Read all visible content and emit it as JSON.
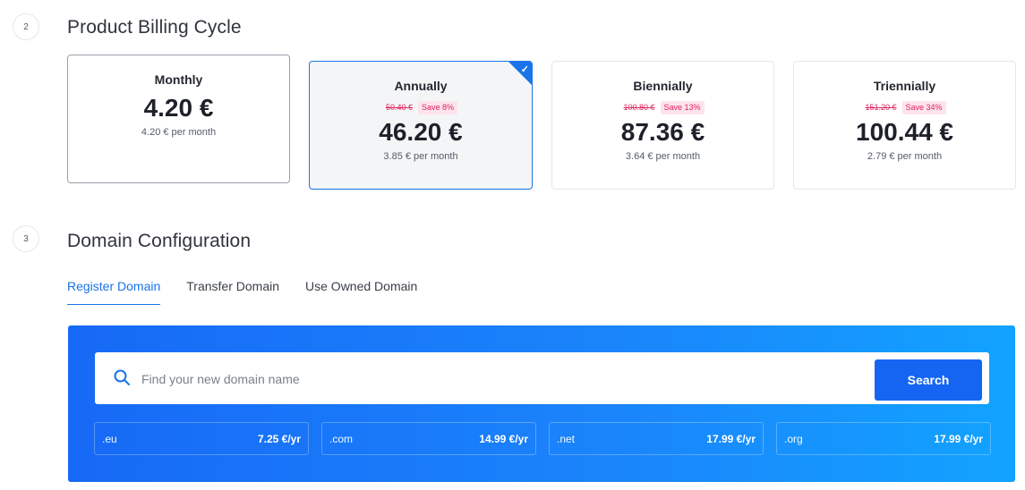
{
  "billing": {
    "step": "2",
    "title": "Product Billing Cycle",
    "cycles": [
      {
        "name": "Monthly",
        "price": "4.20 €",
        "per_month": "4.20 € per month"
      },
      {
        "name": "Annually",
        "old_price": "50.40 €",
        "save": "Save 8%",
        "price": "46.20 €",
        "per_month": "3.85 € per month",
        "selected": true
      },
      {
        "name": "Biennially",
        "old_price": "100.80 €",
        "save": "Save 13%",
        "price": "87.36 €",
        "per_month": "3.64 € per month"
      },
      {
        "name": "Triennially",
        "old_price": "151.20 €",
        "save": "Save 34%",
        "price": "100.44 €",
        "per_month": "2.79 € per month"
      }
    ]
  },
  "domain": {
    "step": "3",
    "title": "Domain Configuration",
    "tabs": [
      {
        "label": "Register Domain",
        "active": true
      },
      {
        "label": "Transfer Domain"
      },
      {
        "label": "Use Owned Domain"
      }
    ],
    "search": {
      "placeholder": "Find your new domain name",
      "button": "Search"
    },
    "tlds": [
      {
        "ext": ".eu",
        "price": "7.25 €/yr"
      },
      {
        "ext": ".com",
        "price": "14.99 €/yr"
      },
      {
        "ext": ".net",
        "price": "17.99 €/yr"
      },
      {
        "ext": ".org",
        "price": "17.99 €/yr"
      }
    ]
  },
  "colors": {
    "accent": "#1a73e8",
    "discount": "#e0245e",
    "panel_gradient_start": "#1769f6",
    "panel_gradient_end": "#12a3ff"
  }
}
